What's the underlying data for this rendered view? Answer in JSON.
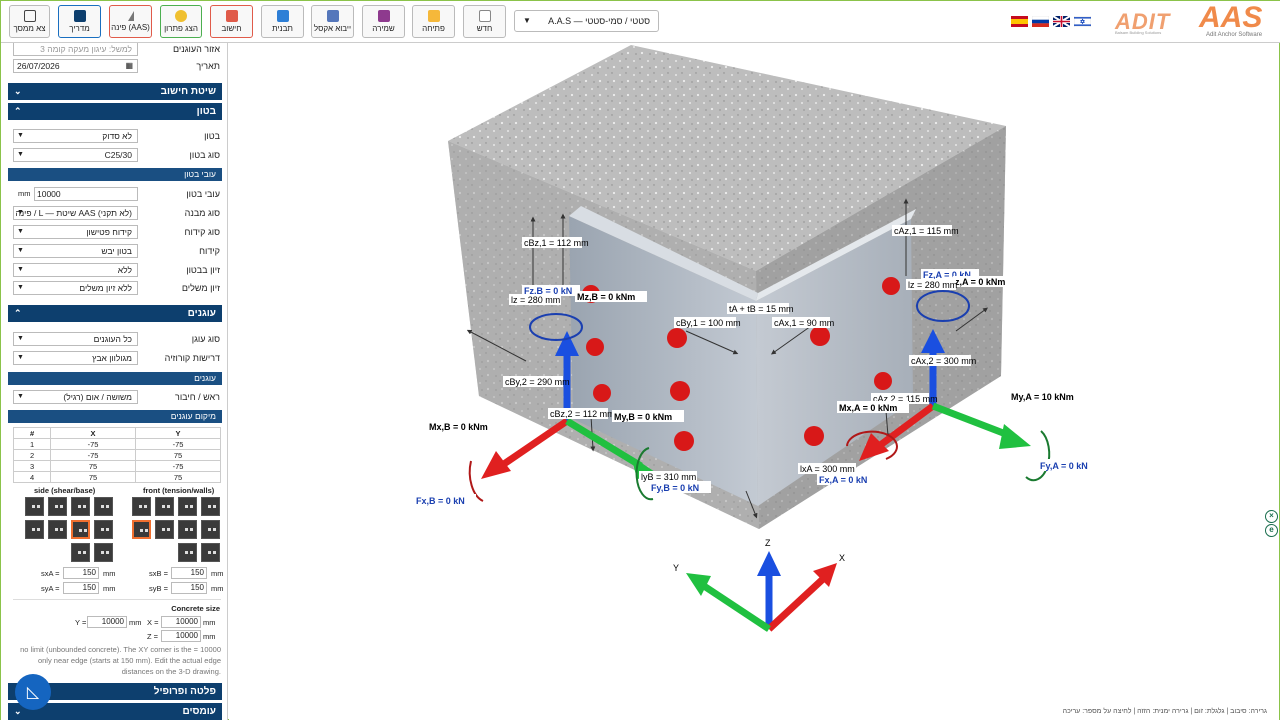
{
  "toolbar": {
    "buttons": [
      {
        "label": "צא ממסך",
        "color": "#444"
      },
      {
        "label": "מדריך",
        "color": "#0d3f6e"
      },
      {
        "label": "פינה (AAS)",
        "color": "#777"
      },
      {
        "label": "הצג פתרון",
        "color": "#f0c030"
      },
      {
        "label": "חישוב",
        "color": "#e05b4a"
      },
      {
        "label": "תבנית",
        "color": "#2e7fd6"
      },
      {
        "label": "ייבוא אקסל",
        "color": "#5577bb"
      },
      {
        "label": "שמירה",
        "color": "#8e3a8e"
      },
      {
        "label": "פתיחה",
        "color": "#f5b83a"
      },
      {
        "label": "חדש",
        "color": "#888"
      }
    ],
    "project_select": "A.A.S — סטטי / סמי-סטטי",
    "logo_adit": "ADIT",
    "logo_adit_sub": "Balsam Building Solutions",
    "logo_aas": "AAS",
    "logo_aas_sub": "Adit Anchor Software",
    "flags": [
      "spain-flag",
      "russia-flag",
      "uk-flag",
      "israel-flag"
    ]
  },
  "sidebar": {
    "area_label": "אזור העוגנים",
    "area_placeholder": "למשל: עיגון מעקה קומה 3",
    "date_label": "תאריך",
    "date_value": "26/07/2026",
    "sec_calc": "שיטת חישוב",
    "sec_concrete": "בטון",
    "concrete_label": "בטון",
    "concrete_value": "לא סדוק",
    "grade_label": "סוג בטון",
    "grade_value": "C25/30",
    "sub_thickness": "עובי בטון",
    "thickness_label": "עובי בטון",
    "thickness_value": "10000",
    "thickness_unit": "mm",
    "structure_label": "סוג מבנה",
    "structure_value": "פינה / L — שיטת AAS (לא תקני)",
    "drill_label": "סוג קידוח",
    "drill_value": "קידוח פטישון",
    "drill_cond_label": "קידוח",
    "drill_cond_value": "בטון יבש",
    "rebar_label": "זיון בבטון",
    "rebar_value": "ללא",
    "edge_rebar_label": "זיון משלים",
    "edge_rebar_value": "ללא זיון משלים",
    "sec_anchors": "עוגנים",
    "anchor_type_label": "סוג עוגן",
    "anchor_type_value": "כל העוגנים",
    "corrosion_label": "דרישות קורוזיה",
    "corrosion_value": "מגולוון אבץ",
    "sub_anchors": "עוגנים",
    "head_label": "ראש / חיבור",
    "head_value": "משושה / אום (רגיל)",
    "sub_positions": "מיקום עוגנים",
    "pos_headers": [
      "#",
      "X",
      "Y"
    ],
    "positions": [
      [
        "1",
        "-75",
        "-75"
      ],
      [
        "2",
        "-75",
        "75"
      ],
      [
        "3",
        "75",
        "-75"
      ],
      [
        "4",
        "75",
        "75"
      ]
    ],
    "side_title": "side (shear/base)",
    "front_title": "front (tension/walls)",
    "sxA_label": "sxA =",
    "sxA_value": "150",
    "syA_label": "syA =",
    "syA_value": "150",
    "sxB_label": "sxB =",
    "sxB_value": "150",
    "syB_label": "syB =",
    "syB_value": "150",
    "unit_mm": "mm",
    "concrete_size_title": "Concrete size",
    "size_x_label": "X =",
    "size_x_value": "10000",
    "size_y_label": "Y =",
    "size_y_value": "10000",
    "size_z_label": "Z =",
    "size_z_value": "10000",
    "note": "no limit (unbounded concrete). The XY corner is the = 10000 only near edge (starts at 150 mm). Edit the actual edge distances on the 3-D drawing.",
    "sec_plate": "פלטה ופרופיל",
    "sec_loads": "עומסים"
  },
  "viewer": {
    "labels": {
      "cBz1": "cBz,1 = 112 mm",
      "cAz1": "cAz,1 = 115 mm",
      "FzB": "Fz,B = 0 kN",
      "FzA": "Fz,A = 0 kN",
      "MzB": "Mz,B = 0 kNm",
      "MzA": "z,A = 0 kNm",
      "lzB": "lz = 280 mm",
      "lzA": "lz = 280 mm",
      "tAtB": "tA + tB = 15 mm",
      "cBy1": "cBy,1 = 100 mm",
      "cAx1": "cAx,1 = 90 mm",
      "cAx2": "cAx,2 = 300 mm",
      "cBy2": "cBy,2 = 290 mm",
      "cAz2": "cAz,2 = 115 mm",
      "cBz2": "cBz,2 = 112 mm",
      "MyB": "My,B = 0 kNm",
      "MxA": "Mx,A = 0 kNm",
      "MyA": "My,A = 10 kNm",
      "MxB": "Mx,B = 0 kNm",
      "lyB": "lyB = 310 mm",
      "FyB": "Fy,B = 0 kN",
      "lxA": "lxA = 300 mm",
      "FxA": "Fx,A = 0 kN",
      "FyA": "Fy,A = 0 kN",
      "FxB": "Fx,B = 0 kN"
    },
    "axes": {
      "x": "X",
      "y": "Y",
      "z": "Z"
    }
  },
  "footer": "גרירה: סיבוב | גלגלת: זום | גרירה ימנית: הזזה | לחיצה על מספר: עריכה",
  "colors": {
    "x_axis": "#e02020",
    "y_axis": "#20c040",
    "z_axis": "#1a4fe0",
    "sidebar_bar": "#0d3f6e",
    "anchor": "#d81818"
  }
}
